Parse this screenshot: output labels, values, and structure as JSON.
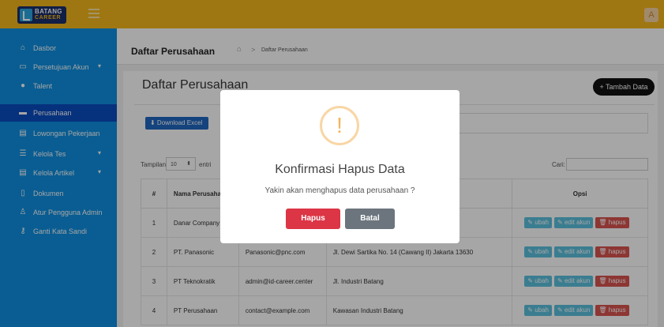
{
  "header": {
    "logo_line1": "BATANG",
    "logo_line2": "CAREER",
    "avatar_initial": "A"
  },
  "sidebar": {
    "items": [
      {
        "label": "Dasbor",
        "icon": "home-icon"
      },
      {
        "label": "Persetujuan Akun",
        "icon": "monitor-icon",
        "caret": "▾"
      },
      {
        "label": "Talent",
        "icon": "user-icon"
      },
      {
        "label": "Perusahaan",
        "icon": "building-icon"
      },
      {
        "label": "Lowongan Pekerjaan",
        "icon": "briefcase-icon"
      },
      {
        "label": "Kelola Tes",
        "icon": "list-icon",
        "caret": "▾"
      },
      {
        "label": "Kelola Artikel",
        "icon": "newspaper-icon",
        "caret": "▾"
      },
      {
        "label": "Dokumen",
        "icon": "document-icon"
      },
      {
        "label": "Atur Pengguna Admin",
        "icon": "user-settings-icon"
      },
      {
        "label": "Ganti Kata Sandi",
        "icon": "key-icon"
      }
    ],
    "active_index": 3
  },
  "breadcrumb": {
    "title": "Daftar Perusahaan",
    "separator": ">",
    "current": "Daftar Perusahaan"
  },
  "card": {
    "title": "Daftar Perusahaan",
    "add_button": "+ Tambah Data",
    "excel_button": "⬇ Download Excel"
  },
  "table_controls": {
    "length_label": "Tampilan",
    "length_value": "10",
    "length_suffix": "entri",
    "search_label": "Cari:"
  },
  "table": {
    "headers": {
      "no": "#",
      "name": "Nama Perusahaan",
      "opsi": "Opsi"
    },
    "rows": [
      {
        "no": "1",
        "name": "Danar Company",
        "email": "",
        "address": ""
      },
      {
        "no": "2",
        "name": "PT. Panasonic",
        "email": "Panasonic@pnc.com",
        "address": "Jl. Dewi Sartika No. 14 (Cawang II) Jakarta 13630"
      },
      {
        "no": "3",
        "name": "PT Teknokratik",
        "email": "admin@id-career.center",
        "address": "Jl. Industri Batang"
      },
      {
        "no": "4",
        "name": "PT Perusahaan",
        "email": "contact@example.com",
        "address": "Kawasan Industri Batang"
      }
    ],
    "actions": {
      "edit": "✎ ubah",
      "edit_account": "✎ edit akun",
      "delete": "🗑 hapus"
    }
  },
  "modal": {
    "icon_glyph": "!",
    "title": "Konfirmasi Hapus Data",
    "text": "Yakin akan menghapus data perusahaan ?",
    "confirm_label": "Hapus",
    "cancel_label": "Batal"
  }
}
